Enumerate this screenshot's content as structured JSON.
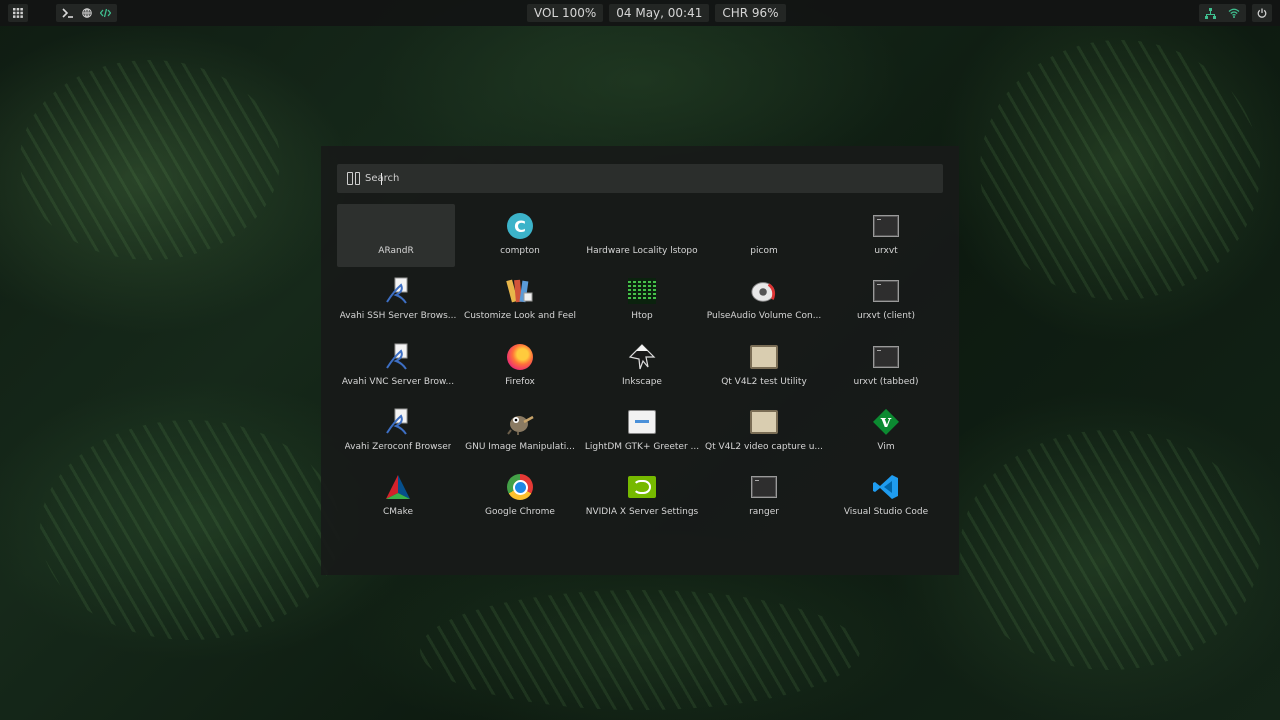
{
  "topbar": {
    "left_icons": [
      "grid-icon",
      "terminal-icon",
      "globe-icon",
      "code-icon"
    ],
    "volume": "VOL 100%",
    "datetime": "04 May, 00:41",
    "charge": "CHR 96%",
    "right_icons": [
      "network-icon",
      "wifi-icon",
      "power-icon"
    ]
  },
  "launcher": {
    "search_placeholder": "Search",
    "apps": [
      {
        "label": "ARandR",
        "icon": "arandr-icon",
        "selected": true
      },
      {
        "label": "compton",
        "icon": "compton-icon"
      },
      {
        "label": "Hardware Locality lstopo",
        "icon": "lstopo-icon"
      },
      {
        "label": "picom",
        "icon": "picom-icon"
      },
      {
        "label": "urxvt",
        "icon": "terminal-icon"
      },
      {
        "label": "Avahi SSH Server Brows...",
        "icon": "avahi-icon"
      },
      {
        "label": "Customize Look and Feel",
        "icon": "appearance-icon"
      },
      {
        "label": "Htop",
        "icon": "htop-icon"
      },
      {
        "label": "PulseAudio Volume Con...",
        "icon": "pulseaudio-icon"
      },
      {
        "label": "urxvt (client)",
        "icon": "terminal-icon"
      },
      {
        "label": "Avahi VNC Server Brow...",
        "icon": "avahi-icon"
      },
      {
        "label": "Firefox",
        "icon": "firefox-icon"
      },
      {
        "label": "Inkscape",
        "icon": "inkscape-icon"
      },
      {
        "label": "Qt V4L2 test Utility",
        "icon": "qt-v4l2-icon"
      },
      {
        "label": "urxvt (tabbed)",
        "icon": "terminal-icon"
      },
      {
        "label": "Avahi Zeroconf Browser",
        "icon": "avahi-icon"
      },
      {
        "label": "GNU Image Manipulati...",
        "icon": "gimp-icon"
      },
      {
        "label": "LightDM GTK+ Greeter ...",
        "icon": "lightdm-icon"
      },
      {
        "label": "Qt V4L2 video capture u...",
        "icon": "qt-v4l2-icon"
      },
      {
        "label": "Vim",
        "icon": "vim-icon"
      },
      {
        "label": "CMake",
        "icon": "cmake-icon"
      },
      {
        "label": "Google Chrome",
        "icon": "chrome-icon"
      },
      {
        "label": "NVIDIA X Server Settings",
        "icon": "nvidia-icon"
      },
      {
        "label": "ranger",
        "icon": "terminal-icon"
      },
      {
        "label": "Visual Studio Code",
        "icon": "vscode-icon"
      }
    ]
  },
  "colors": {
    "accent": "#3fbf8f",
    "bar_bg": "#121413",
    "panel_bg": "#181a19",
    "search_bg": "#2b2e2c"
  }
}
